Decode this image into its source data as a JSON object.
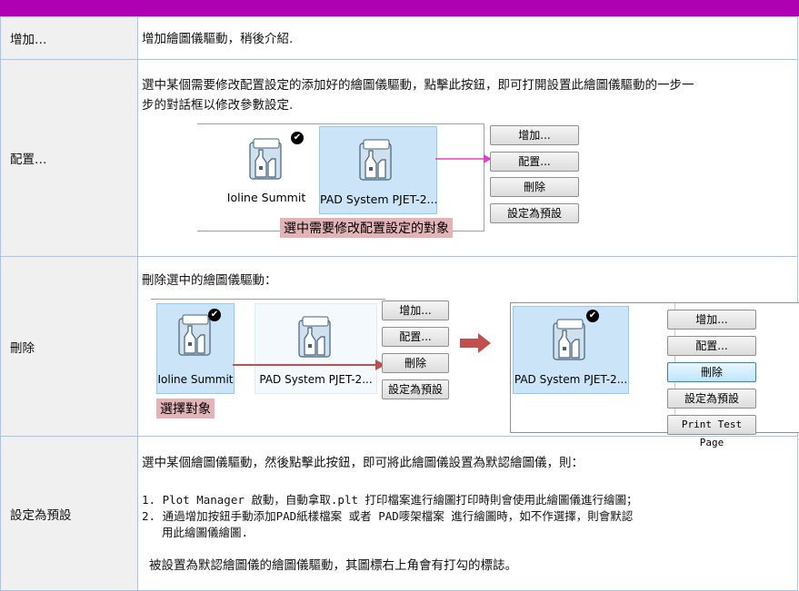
{
  "rows": [
    {
      "label": "增加…",
      "desc": "增加繪圖儀驅動，稍後介紹."
    },
    {
      "label": "配置…",
      "desc_line1": "選中某個需要修改配置設定的添加好的繪圖儀驅動，點擊此按鈕，即可打開設置此繪圖儀驅動的一步一",
      "desc_line2": "步的對話框以修改參數設定."
    },
    {
      "label": "刪除",
      "desc": "刪除選中的繪圖儀驅動："
    },
    {
      "label": "設定為預設",
      "desc": "選中某個繪圖儀驅動，然後點擊此按鈕，即可將此繪圖儀設置為默認繪圖儀，則：",
      "item1": "1. Plot Manager 啟動，自動拿取.plt 打印檔案進行繪圖打印時則會使用此繪圖儀進行繪圖；",
      "item2_line1": "2. 通過增加按鈕手動添加PAD紙樣檔案 或者 PAD嘜架檔案 進行繪圖時，如不作選擇，則會默認",
      "item2_line2": "用此繪圖儀繪圖.",
      "note": "被設置為默認繪圖儀的繪圖儀驅動，其圖標右上角會有打勾的標誌。"
    }
  ],
  "buttons": {
    "add": "增加...",
    "config": "配置...",
    "delete": "刪除",
    "set_default": "設定為預設",
    "print_test": "Print Test Page"
  },
  "plotters": {
    "ioline": "Ioline Summit",
    "pad": "PAD System PJET-2..."
  },
  "captions": {
    "config_select": "選中需要修改配置設定的對象",
    "select_object": "選擇對象"
  },
  "colors": {
    "top_bar": "#b000b4",
    "border": "#a9c4e4",
    "arrow_pink": "#e040c8",
    "arrow_red": "#c0504d"
  }
}
